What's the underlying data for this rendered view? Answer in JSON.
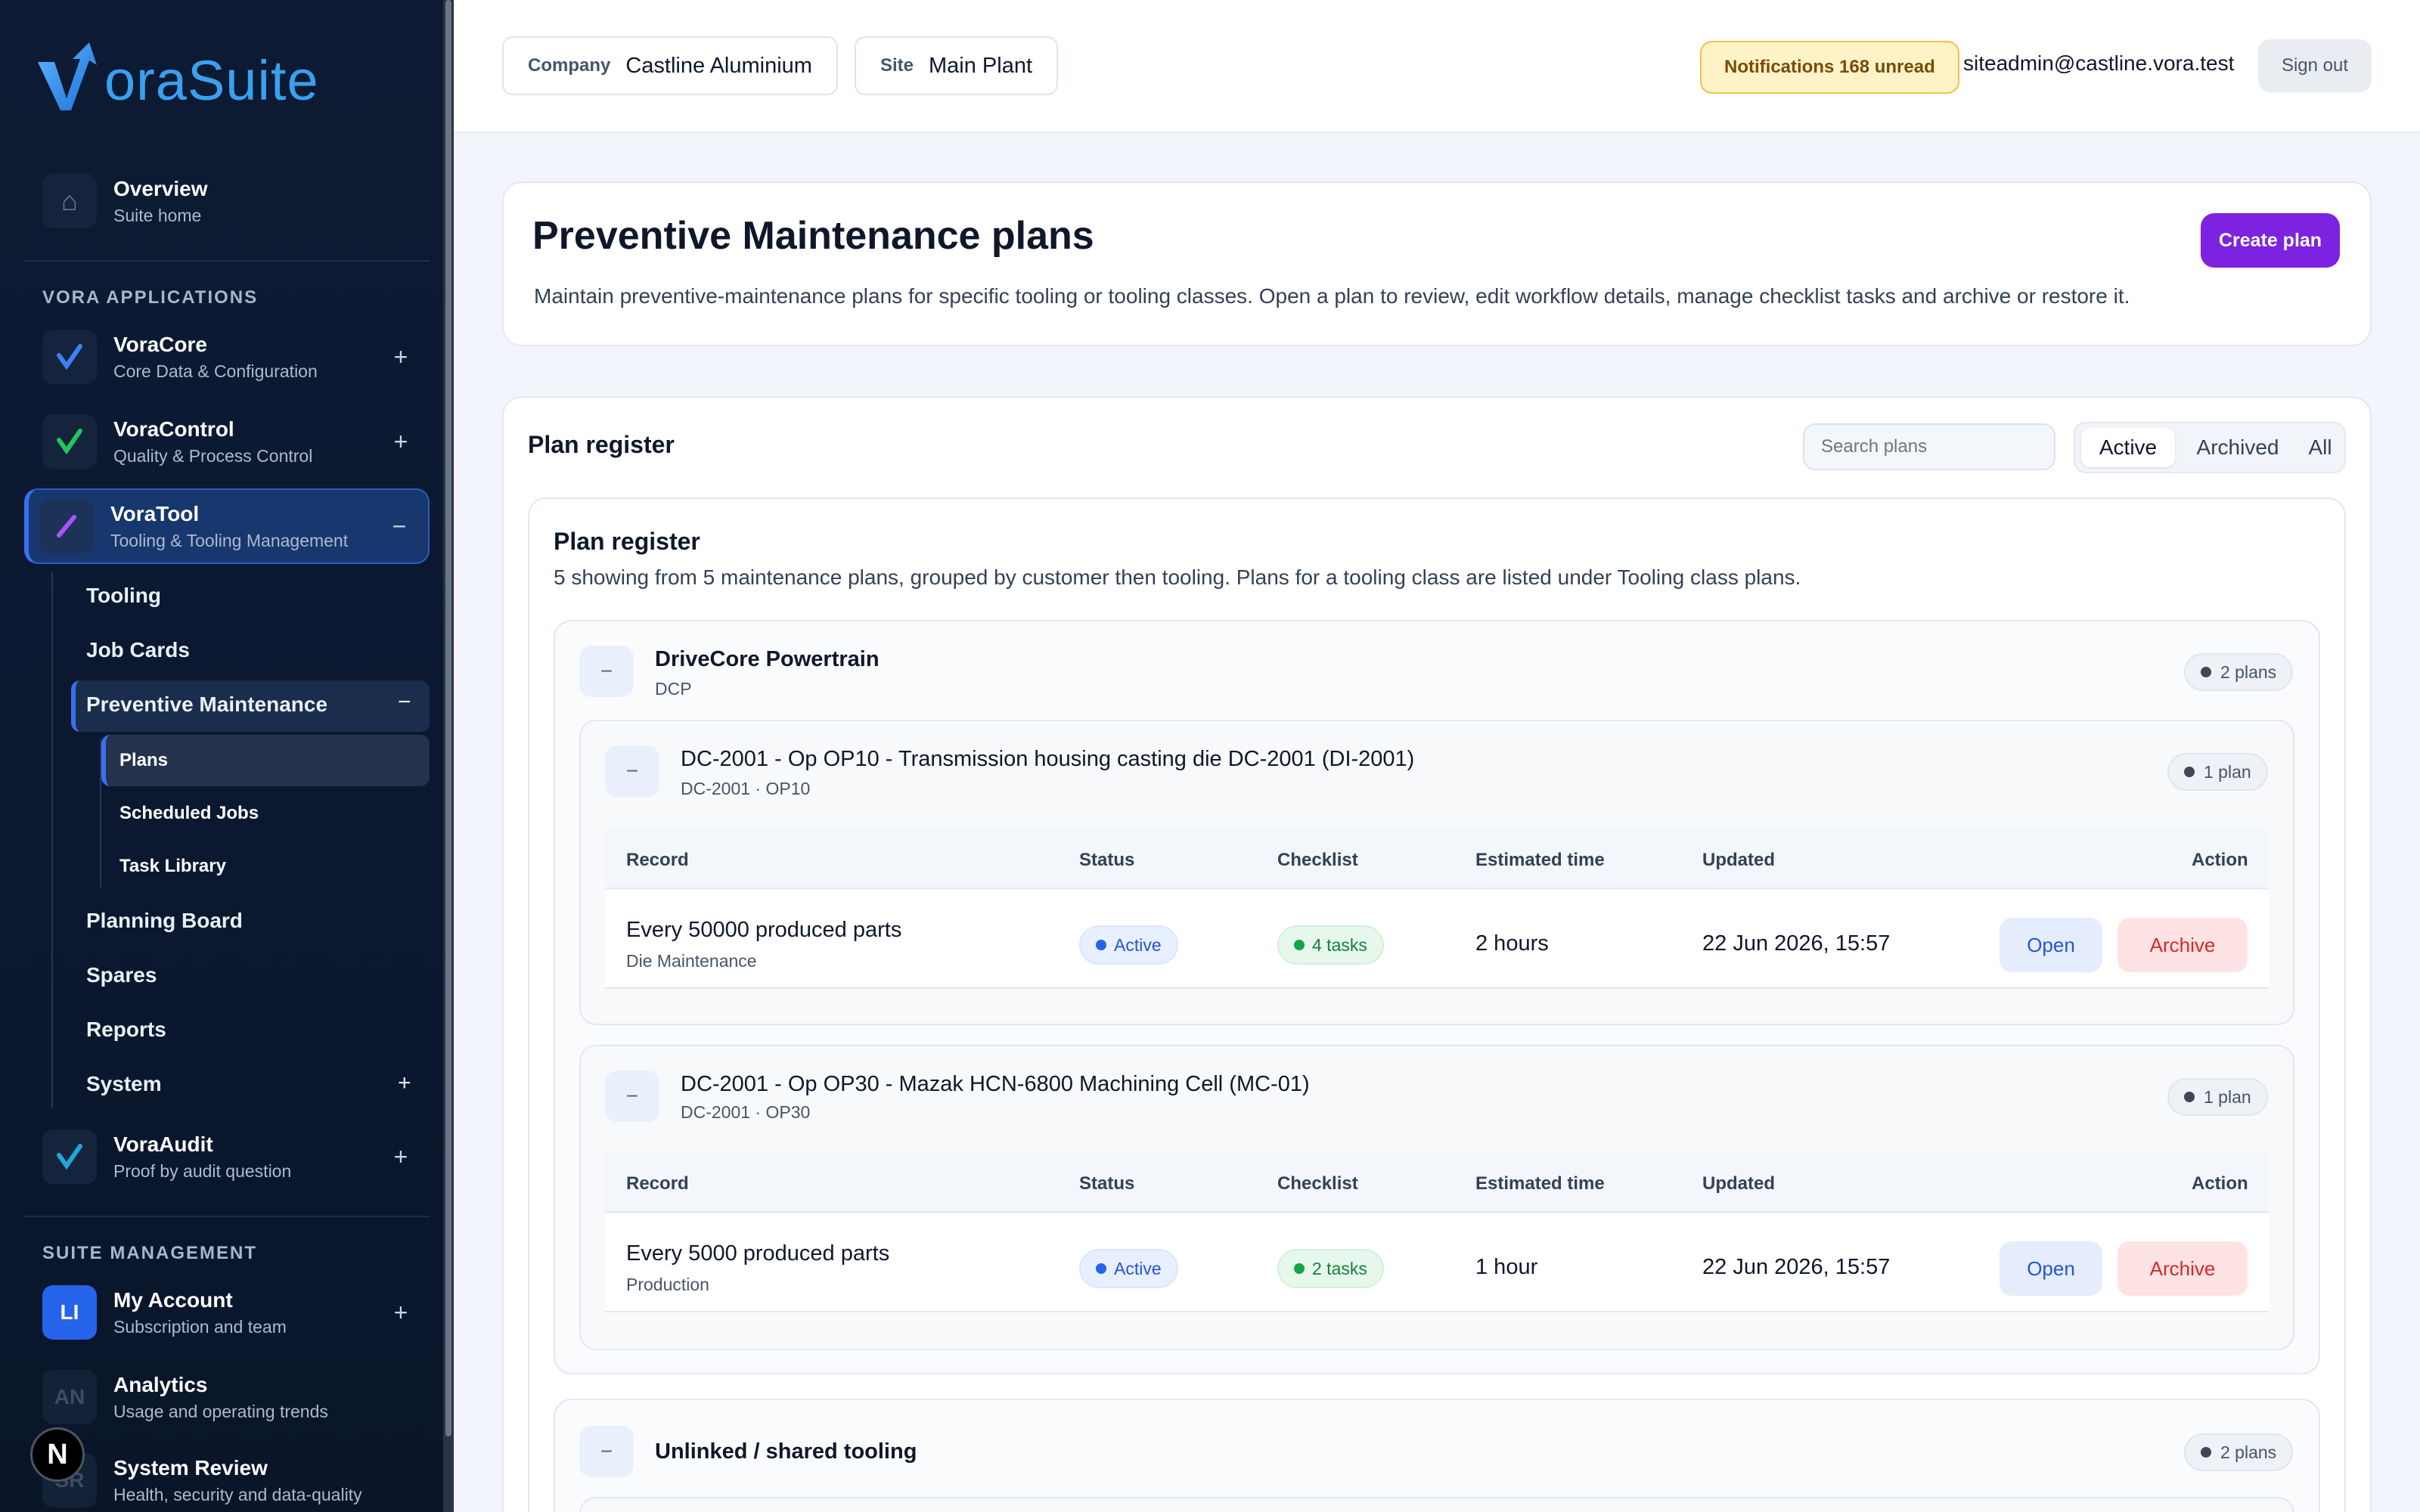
{
  "brand": {
    "word": "oraSuite",
    "colors": {
      "accent": "#7c22e0",
      "brand_blue": "#39a0f0",
      "sidebar_bg": "#0c1a33"
    }
  },
  "sidebar": {
    "overview": {
      "title": "Overview",
      "subtitle": "Suite home",
      "icon": "home-icon"
    },
    "apps_section": "VORA APPLICATIONS",
    "apps": [
      {
        "title": "VoraCore",
        "subtitle": "Core Data & Configuration",
        "toggle": "+",
        "icon": "check-icon"
      },
      {
        "title": "VoraControl",
        "subtitle": "Quality & Process Control",
        "toggle": "+",
        "icon": "check-icon"
      },
      {
        "title": "VoraTool",
        "subtitle": "Tooling & Tooling Management",
        "toggle": "−",
        "icon": "slash-icon"
      },
      {
        "title": "VoraAudit",
        "subtitle": "Proof by audit question",
        "toggle": "+",
        "icon": "check-icon"
      }
    ],
    "tool_items": [
      "Tooling",
      "Job Cards",
      "Preventive Maintenance",
      "Planning Board",
      "Spares",
      "Reports",
      "System"
    ],
    "pm_toggle": "−",
    "system_toggle": "+",
    "pm_items": [
      "Plans",
      "Scheduled Jobs",
      "Task Library"
    ],
    "mgmt_section": "SUITE MANAGEMENT",
    "mgmt": [
      {
        "tag": "LI",
        "title": "My Account",
        "subtitle": "Subscription and team",
        "toggle": "+"
      },
      {
        "tag": "AN",
        "title": "Analytics",
        "subtitle": "Usage and operating trends"
      },
      {
        "tag": "SR",
        "title": "System Review",
        "subtitle": "Health, security and data-quality"
      }
    ],
    "bubble": "N"
  },
  "header": {
    "company_label": "Company",
    "company_value": "Castline Aluminium",
    "site_label": "Site",
    "site_value": "Main Plant",
    "notifications": "Notifications 168 unread",
    "user": "siteadmin@castline.vora.test",
    "sign_out": "Sign out"
  },
  "page": {
    "title": "Preventive Maintenance plans",
    "description": "Maintain preventive-maintenance plans for specific tooling or tooling classes. Open a plan to review, edit workflow details, manage checklist tasks and archive or restore it.",
    "create": "Create plan"
  },
  "register": {
    "title": "Plan register",
    "search_placeholder": "Search plans",
    "filters": [
      "Active",
      "Archived",
      "All"
    ],
    "inner_title": "Plan register",
    "inner_desc": "5 showing from 5 maintenance plans, grouped by customer then tooling. Plans for a tooling class are listed under Tooling class plans.",
    "columns": [
      "Record",
      "Status",
      "Checklist",
      "Estimated time",
      "Updated",
      "Action"
    ],
    "customers": [
      {
        "toggle": "−",
        "name": "DriveCore Powertrain",
        "code": "DCP",
        "count": "2 plans",
        "toolings": [
          {
            "toggle": "−",
            "name": "DC-2001 - Op OP10 - Transmission housing casting die DC-2001 (DI-2001)",
            "sub": "DC-2001 · OP10",
            "count": "1 plan",
            "rows": [
              {
                "record": "Every 50000 produced parts",
                "sub": "Die Maintenance",
                "status": "Active",
                "checklist": "4 tasks",
                "time": "2 hours",
                "updated": "22 Jun 2026, 15:57",
                "open": "Open",
                "archive": "Archive"
              }
            ]
          },
          {
            "toggle": "−",
            "name": "DC-2001 - Op OP30 - Mazak HCN-6800 Machining Cell (MC-01)",
            "sub": "DC-2001 · OP30",
            "count": "1 plan",
            "rows": [
              {
                "record": "Every 5000 produced parts",
                "sub": "Production",
                "status": "Active",
                "checklist": "2 tasks",
                "time": "1 hour",
                "updated": "22 Jun 2026, 15:57",
                "open": "Open",
                "archive": "Archive"
              }
            ]
          }
        ]
      },
      {
        "toggle": "−",
        "name": "Unlinked / shared tooling",
        "count": "2 plans"
      }
    ]
  }
}
